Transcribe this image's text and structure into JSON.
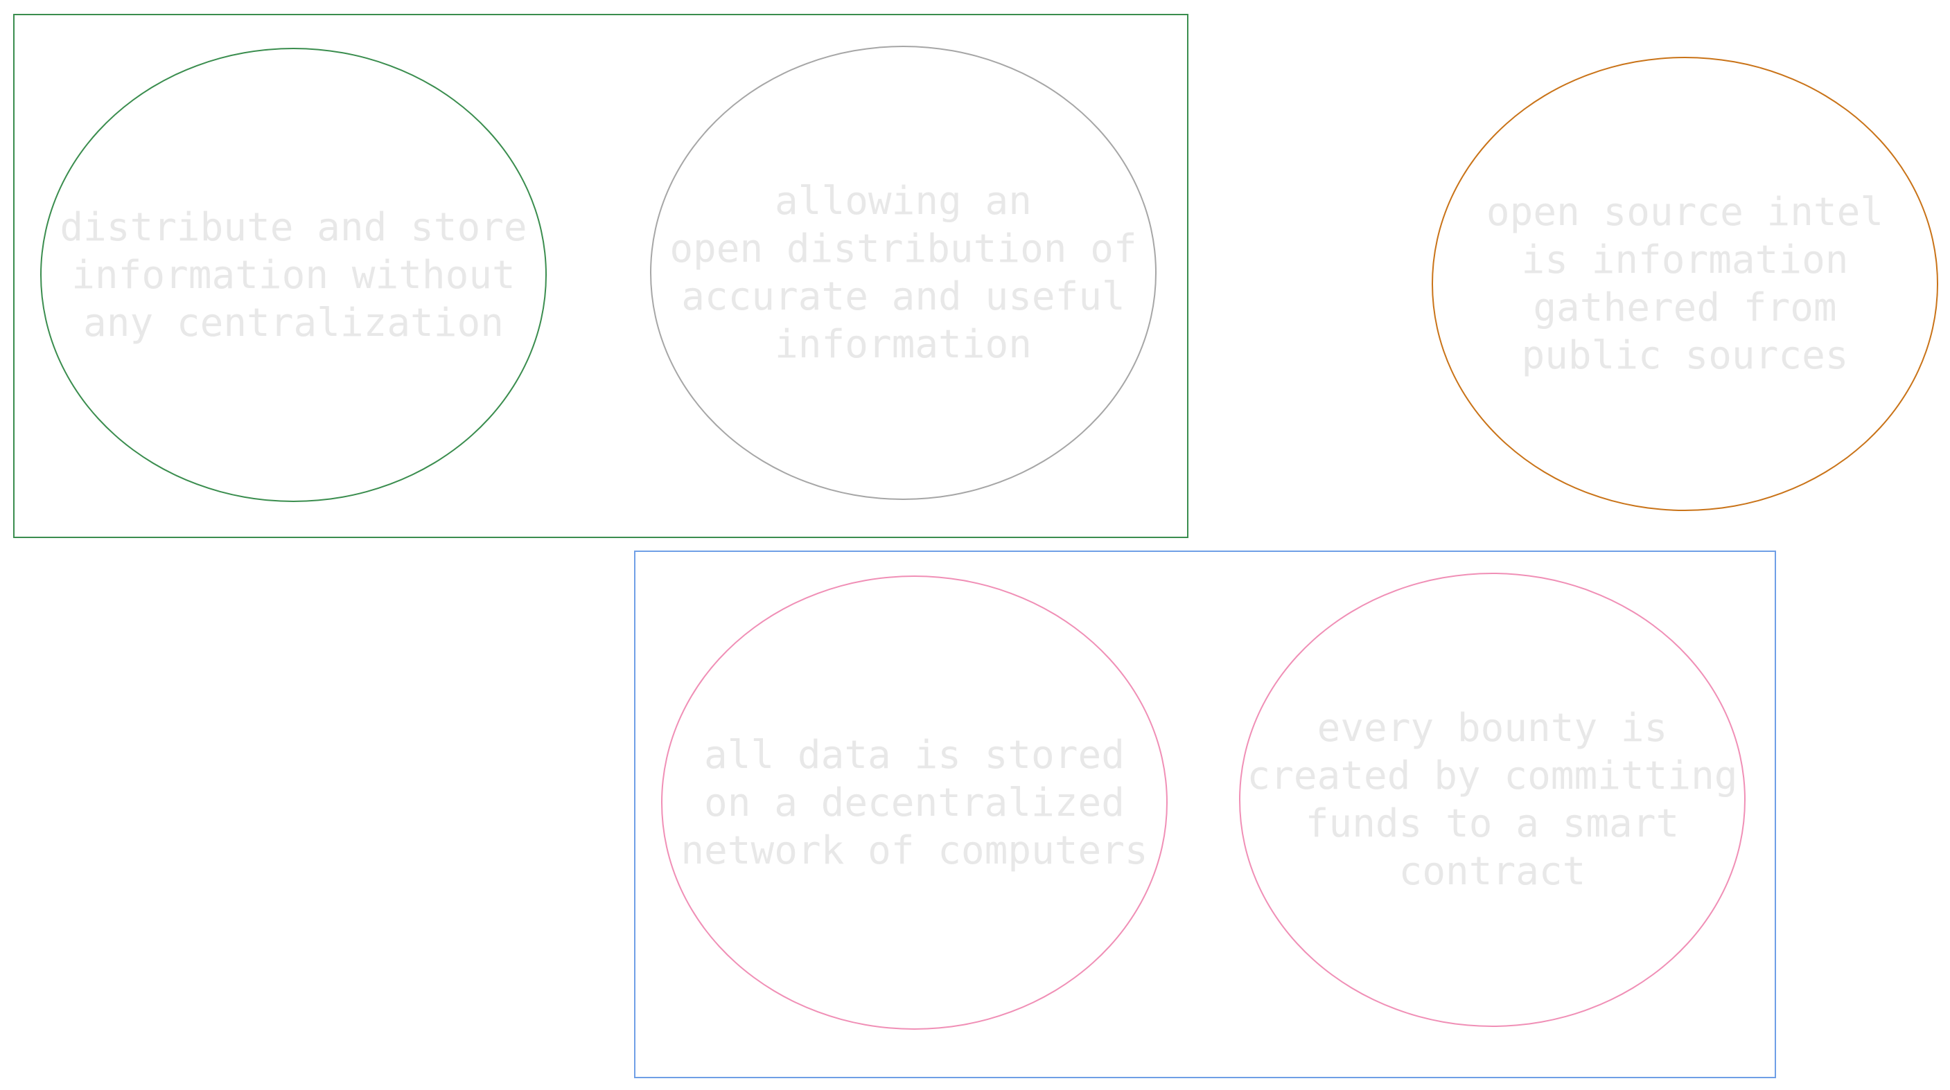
{
  "colors": {
    "text": "#e8e8e8",
    "frame_top_left": "#3a8d4e",
    "frame_bottom": "#6f9fe6",
    "node_green": "#3a8d4e",
    "node_gray": "#a6a6a6",
    "node_orange": "#c97318",
    "node_pink": "#f08fb6"
  },
  "diagram": {
    "nodes": [
      {
        "id": "decentralized-storage",
        "text": "distribute and store\ninformation without\nany centralization"
      },
      {
        "id": "open-distribution",
        "text": "allowing an\nopen distribution of\naccurate and useful\ninformation"
      },
      {
        "id": "osint-definition",
        "text": "open source intel\nis information\ngathered from\npublic sources"
      },
      {
        "id": "decentralized-network",
        "text": "all data is stored\non a decentralized\nnetwork of computers"
      },
      {
        "id": "bounty-smart-contract",
        "text": "every bounty is\ncreated by committing\nfunds to a smart\ncontract"
      }
    ]
  }
}
